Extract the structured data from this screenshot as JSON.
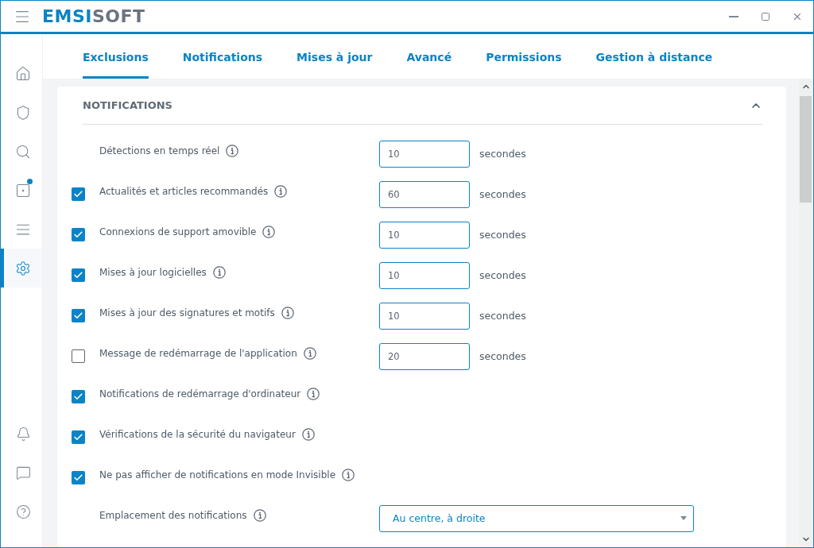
{
  "logo": {
    "primary": "EMSI",
    "secondary": "SOFT"
  },
  "sidebar": {
    "items": [
      {
        "selected": false,
        "badge": false
      },
      {
        "selected": false,
        "badge": false
      },
      {
        "selected": false,
        "badge": false
      },
      {
        "selected": false,
        "badge": true
      },
      {
        "selected": false,
        "badge": false
      },
      {
        "selected": true,
        "badge": false
      }
    ]
  },
  "tabs": [
    {
      "label": "Exclusions",
      "selected": true
    },
    {
      "label": "Notifications",
      "selected": false
    },
    {
      "label": "Mises à jour",
      "selected": false
    },
    {
      "label": "Avancé",
      "selected": false
    },
    {
      "label": "Permissions",
      "selected": false
    },
    {
      "label": "Gestion à distance",
      "selected": false
    }
  ],
  "section": {
    "title": "NOTIFICATIONS",
    "expanded": true,
    "rows": [
      {
        "kind": "number",
        "label": "Détections en temps réel",
        "value": "10",
        "unit": "secondes"
      },
      {
        "kind": "number",
        "label": "Actualités et articles recommandés",
        "checked": true,
        "value": "60",
        "unit": "secondes"
      },
      {
        "kind": "number",
        "label": "Connexions de support amovible",
        "checked": true,
        "value": "10",
        "unit": "secondes"
      },
      {
        "kind": "number",
        "label": "Mises à jour logicielles",
        "checked": true,
        "value": "10",
        "unit": "secondes"
      },
      {
        "kind": "number",
        "label": "Mises à jour des signatures et motifs",
        "checked": true,
        "value": "10",
        "unit": "secondes"
      },
      {
        "kind": "number",
        "label": "Message de redémarrage de l'application",
        "checked": false,
        "value": "20",
        "unit": "secondes"
      },
      {
        "kind": "toggle",
        "label": "Notifications de redémarrage d'ordinateur",
        "checked": true
      },
      {
        "kind": "toggle",
        "label": "Vérifications de la sécurité du navigateur",
        "checked": true
      },
      {
        "kind": "toggle",
        "label": "Ne pas afficher de notifications en mode Invisible",
        "checked": true
      },
      {
        "kind": "dropdown",
        "label": "Emplacement des notifications",
        "value": "Au centre, à droite"
      }
    ]
  }
}
